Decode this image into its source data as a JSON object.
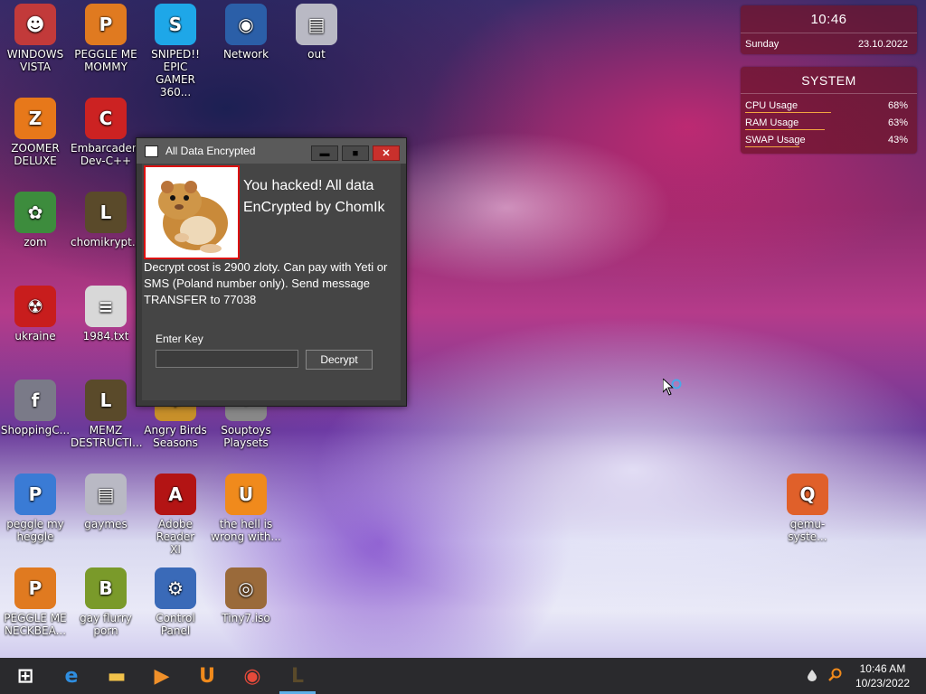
{
  "desktop": {
    "icons": [
      {
        "label": "WINDOWS\nVISTA",
        "icon": "vista-robot-icon",
        "color": "#c23a3a",
        "glyph": "☻"
      },
      {
        "label": "PEGGLE ME\nMOMMY",
        "icon": "peggle-icon",
        "color": "#e07a20",
        "glyph": "P"
      },
      {
        "label": "SNIPED!! EPIC\nGAMER 360...",
        "icon": "skype-icon",
        "color": "#1ea7e8",
        "glyph": "S"
      },
      {
        "label": "Network",
        "icon": "network-globe-icon",
        "color": "#2b5fa8",
        "glyph": "◉"
      },
      {
        "label": "out",
        "icon": "folder-icon",
        "color": "#b9b9c4",
        "glyph": "▤"
      },
      {
        "label": "ZOOMER\nDELUXE",
        "icon": "zoomer-icon",
        "color": "#e7781a",
        "glyph": "Z"
      },
      {
        "label": "Embarcadero\nDev-C++",
        "icon": "devcpp-icon",
        "color": "#cc2222",
        "glyph": "C"
      },
      {
        "label": "zom",
        "icon": "flower-icon",
        "color": "#3d8c3d",
        "glyph": "✿"
      },
      {
        "label": "chomikrypt...",
        "icon": "chomikrypt-icon",
        "color": "#5a4a2a",
        "glyph": "L"
      },
      {
        "label": "ukraine",
        "icon": "radiation-icon",
        "color": "#c81d1d",
        "glyph": "☢"
      },
      {
        "label": "1984.txt",
        "icon": "text-file-icon",
        "color": "#d8d8d8",
        "glyph": "≡"
      },
      {
        "label": "ShoppingC...",
        "icon": "flash-icon",
        "color": "#7a7a88",
        "glyph": "f"
      },
      {
        "label": "MEMZ\nDESTRUCTI...",
        "icon": "memz-icon",
        "color": "#5a4a2a",
        "glyph": "L"
      },
      {
        "label": "Angry Birds\nSeasons",
        "icon": "angry-birds-icon",
        "color": "#c8902a",
        "glyph": "♣"
      },
      {
        "label": "Souptoys\nPlaysets",
        "icon": "souptoys-icon",
        "color": "#888",
        "glyph": "✦"
      },
      {
        "label": "peggle my\nheggle",
        "icon": "peggle-icon",
        "color": "#3a7bd5",
        "glyph": "P"
      },
      {
        "label": "gaymes",
        "icon": "folder-icon",
        "color": "#b9b9c4",
        "glyph": "▤"
      },
      {
        "label": "Adobe Reader\nXI",
        "icon": "adobe-reader-icon",
        "color": "#b31414",
        "glyph": "A"
      },
      {
        "label": "the hell is\nwrong with...",
        "icon": "uc-browser-icon",
        "color": "#f08a1c",
        "glyph": "U"
      },
      {
        "label": "PEGGLE ME\nNECKBEA...",
        "icon": "peggle-icon",
        "color": "#e07a20",
        "glyph": "P"
      },
      {
        "label": "gay flurry\nporn",
        "icon": "bonzi-box-icon",
        "color": "#7a9a2a",
        "glyph": "B"
      },
      {
        "label": "Control Panel",
        "icon": "control-panel-icon",
        "color": "#3a6ab8",
        "glyph": "⚙"
      },
      {
        "label": "Tiny7.iso",
        "icon": "disc-icon",
        "color": "#9a6a3a",
        "glyph": "◎"
      },
      {
        "label": "qemu-syste...",
        "icon": "qemu-icon",
        "color": "#e0602a",
        "glyph": "Q"
      }
    ]
  },
  "widgets": {
    "clock": {
      "time": "10:46",
      "day": "Sunday",
      "date": "23.10.2022"
    },
    "system": {
      "title": "SYSTEM",
      "metrics": [
        {
          "label": "CPU Usage",
          "value": "68%",
          "fraction": 0.68
        },
        {
          "label": "RAM Usage",
          "value": "63%",
          "fraction": 0.63
        },
        {
          "label": "SWAP Usage",
          "value": "43%",
          "fraction": 0.43
        }
      ]
    }
  },
  "dialog": {
    "title": "All Data Encrypted",
    "headline": "You hacked! All data EnCrypted by ChomIk",
    "message": "Decrypt cost is 2900 zloty. Can pay with Yeti or SMS (Poland number only). Send message TRANSFER to 77038",
    "key_label": "Enter Key",
    "key_value": "",
    "decrypt_label": "Decrypt",
    "minimize_glyph": "▬",
    "maximize_glyph": "■",
    "close_glyph": "✕"
  },
  "taskbar": {
    "items": [
      {
        "icon": "windows-start-icon",
        "color": "#ffffff",
        "glyph": "⊞"
      },
      {
        "icon": "internet-explorer-icon",
        "color": "#2f8ee0",
        "glyph": "e"
      },
      {
        "icon": "file-explorer-icon",
        "color": "#f2c24a",
        "glyph": "▬"
      },
      {
        "icon": "media-player-icon",
        "color": "#f0902a",
        "glyph": "▶"
      },
      {
        "icon": "uc-browser-icon",
        "color": "#f08a1c",
        "glyph": "U"
      },
      {
        "icon": "chrome-icon",
        "color": "#e64a3a",
        "glyph": "◉"
      },
      {
        "icon": "chomikrypt-icon",
        "color": "#5a4a2a",
        "glyph": "L"
      }
    ],
    "time": "10:46 AM",
    "date": "10/23/2022"
  }
}
